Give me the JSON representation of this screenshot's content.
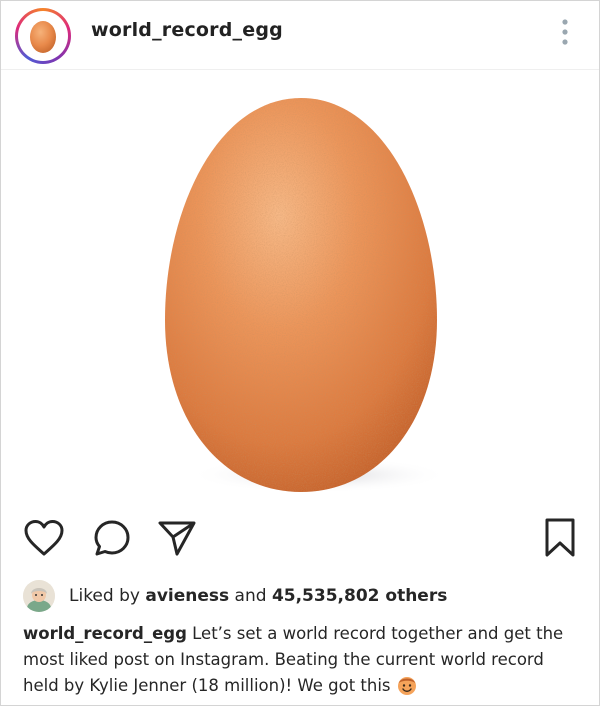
{
  "post": {
    "username": "world_record_egg",
    "image_alt": "brown egg on white background"
  },
  "actions": {
    "like": "heart-icon",
    "comment": "comment-icon",
    "share": "paper-plane-icon",
    "save": "bookmark-icon"
  },
  "likes": {
    "prefix": "Liked by",
    "liker": "avieness",
    "joiner": "and",
    "count": "45,535,802 others"
  },
  "caption": {
    "username": "world_record_egg",
    "text": "Let’s set a world record together and get the most liked post on Instagram. Beating the current world record held by Kylie Jenner (18 million)! We got this",
    "emoji": "smiling-face-emoji"
  },
  "colors": {
    "egg": "#e8894a",
    "egg_highlight": "#f6b27a",
    "ring_start": "#f58529",
    "ring_end": "#515bd4"
  }
}
